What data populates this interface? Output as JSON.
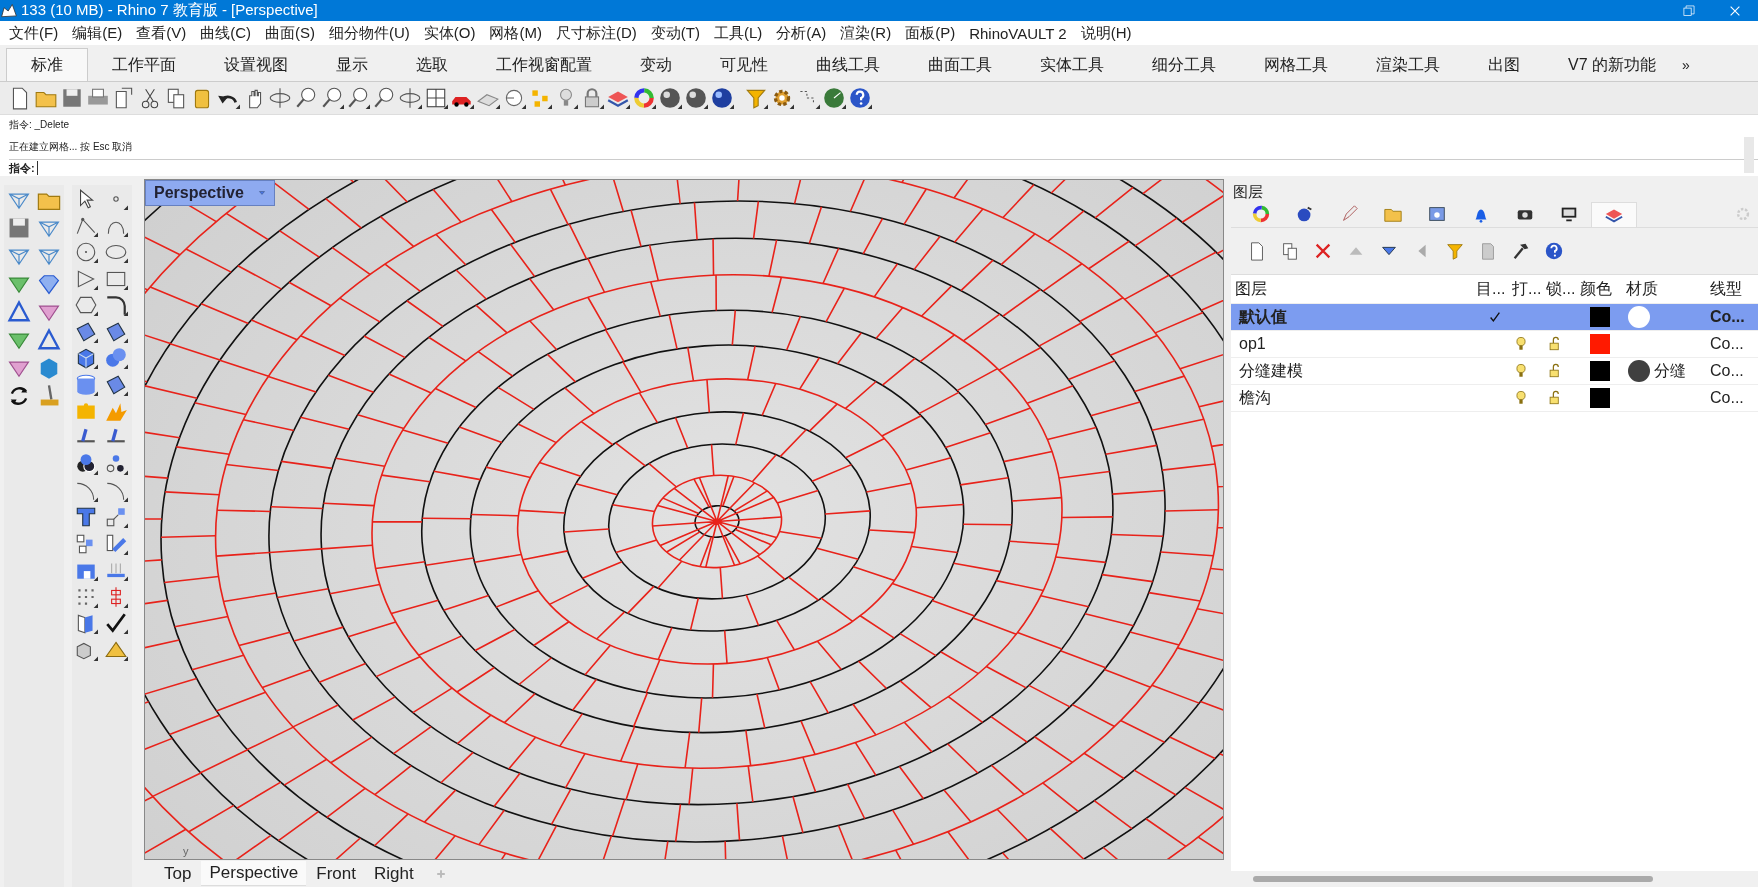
{
  "window": {
    "title": "133 (10 MB) - Rhino 7 教育版 - [Perspective]"
  },
  "menu": [
    "文件(F)",
    "编辑(E)",
    "查看(V)",
    "曲线(C)",
    "曲面(S)",
    "细分物件(U)",
    "实体(O)",
    "网格(M)",
    "尺寸标注(D)",
    "变动(T)",
    "工具(L)",
    "分析(A)",
    "渲染(R)",
    "面板(P)",
    "RhinoVAULT 2",
    "说明(H)"
  ],
  "ribbon_tabs": [
    {
      "label": "标准",
      "selected": true
    },
    {
      "label": "工作平面",
      "selected": false
    },
    {
      "label": "设置视图",
      "selected": false
    },
    {
      "label": "显示",
      "selected": false
    },
    {
      "label": "选取",
      "selected": false
    },
    {
      "label": "工作视窗配置",
      "selected": false
    },
    {
      "label": "变动",
      "selected": false
    },
    {
      "label": "可见性",
      "selected": false
    },
    {
      "label": "曲线工具",
      "selected": false
    },
    {
      "label": "曲面工具",
      "selected": false
    },
    {
      "label": "实体工具",
      "selected": false
    },
    {
      "label": "细分工具",
      "selected": false
    },
    {
      "label": "网格工具",
      "selected": false
    },
    {
      "label": "渲染工具",
      "selected": false
    },
    {
      "label": "出图",
      "selected": false
    },
    {
      "label": "V7 的新功能",
      "selected": false
    }
  ],
  "ribbon_more": "»",
  "command": {
    "history": [
      "指令: _Delete",
      "正在建立网格... 按 Esc 取消"
    ],
    "prompt": "指令:"
  },
  "viewport": {
    "title": "Perspective",
    "axis_label": "y"
  },
  "viewport_tabs": [
    {
      "label": "Top",
      "selected": false
    },
    {
      "label": "Perspective",
      "selected": true
    },
    {
      "label": "Front",
      "selected": false
    },
    {
      "label": "Right",
      "selected": false
    }
  ],
  "layers_panel": {
    "title": "图层",
    "tabs": [
      {
        "selected": false
      },
      {
        "selected": false
      },
      {
        "selected": false
      },
      {
        "selected": false
      },
      {
        "selected": false
      },
      {
        "selected": false
      },
      {
        "selected": false
      },
      {
        "selected": false
      },
      {
        "selected": true
      }
    ],
    "columns": [
      "图层",
      "目...",
      "打...",
      "锁...",
      "颜色",
      "材质",
      "线型"
    ],
    "rows": [
      {
        "name": "默认值",
        "selected": true,
        "current": true,
        "icons": false,
        "color": "#000000",
        "material": {
          "color": "#ffffff"
        },
        "linetype": "Co..."
      },
      {
        "name": "op1",
        "selected": false,
        "current": false,
        "icons": true,
        "color": "#ff1a00",
        "linetype": "Co..."
      },
      {
        "name": "分缝建模",
        "selected": false,
        "current": false,
        "icons": true,
        "color": "#000000",
        "material": {
          "color": "#404040",
          "name": "分缝"
        },
        "linetype": "Co..."
      },
      {
        "name": "檐沟",
        "selected": false,
        "current": false,
        "icons": true,
        "color": "#000000",
        "linetype": "Co..."
      }
    ]
  }
}
